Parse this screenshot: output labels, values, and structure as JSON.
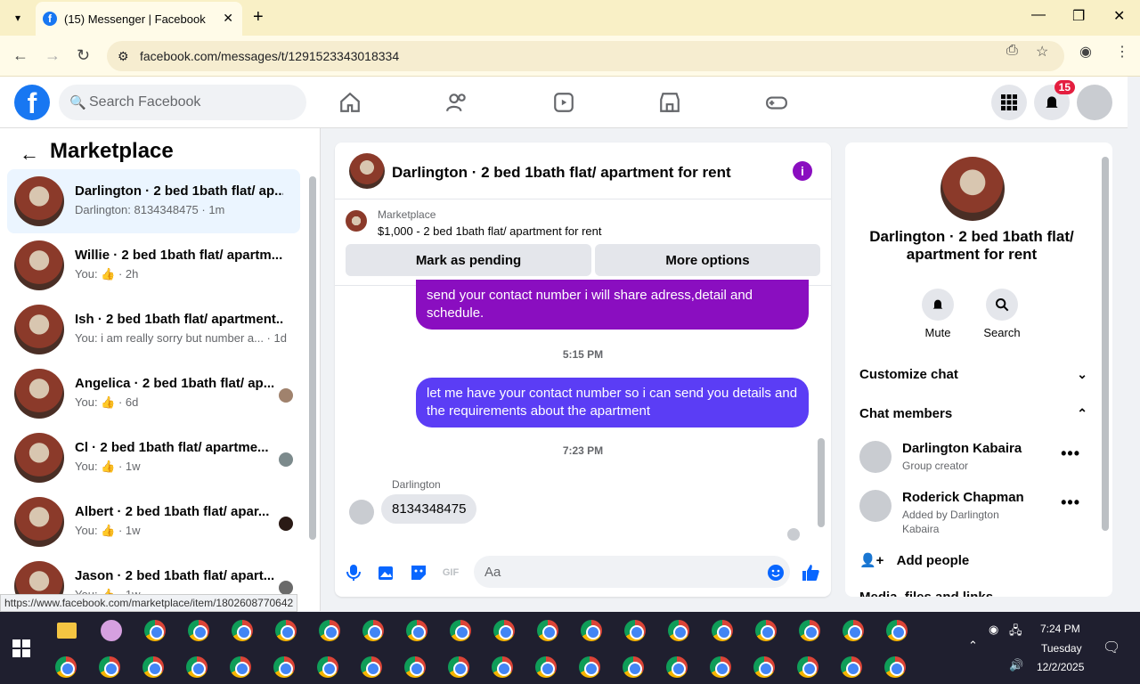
{
  "browser": {
    "tab_title": "(15) Messenger | Facebook",
    "url": "facebook.com/messages/t/1291523343018334"
  },
  "fb": {
    "search_placeholder": "Search Facebook",
    "notif_count": "15"
  },
  "left": {
    "title": "Marketplace",
    "conversations": [
      {
        "title": "Darlington · 2 bed 1bath flat/ ap...",
        "sub": "Darlington: 8134348475 · 1m"
      },
      {
        "title": "Willie · 2 bed 1bath flat/ apartm...",
        "sub": "You: 👍 · 2h"
      },
      {
        "title": "Ish · 2 bed 1bath flat/ apartment...",
        "sub": "You: i am really sorry but number a... · 1d"
      },
      {
        "title": "Angelica · 2 bed 1bath flat/ ap...",
        "sub": "You: 👍 · 6d"
      },
      {
        "title": "Cl · 2 bed 1bath flat/ apartme...",
        "sub": "You: 👍 · 1w"
      },
      {
        "title": "Albert · 2 bed 1bath flat/ apar...",
        "sub": "You: 👍 · 1w"
      },
      {
        "title": "Jason · 2 bed 1bath flat/ apart...",
        "sub": "You: 👍 · 1w"
      }
    ]
  },
  "chat": {
    "title": "Darlington · 2 bed 1bath flat/ apartment for rent",
    "marketplace_label": "Marketplace",
    "listing": "$1,000 - 2 bed 1bath flat/ apartment for rent",
    "mark_pending": "Mark as pending",
    "more_options": "More options",
    "msg1": "send your contact number i will share adress,detail and schedule.",
    "time1": "5:15 PM",
    "msg2": "let me have your contact number so i can send you details and the requirements about the apartment",
    "time2": "7:23 PM",
    "sender": "Darlington",
    "incoming": "8134348475",
    "composer_placeholder": "Aa"
  },
  "right": {
    "title": "Darlington · 2 bed 1bath flat/ apartment for rent",
    "mute": "Mute",
    "search": "Search",
    "customize": "Customize chat",
    "members_header": "Chat members",
    "members": [
      {
        "name": "Darlington Kabaira",
        "sub": "Group creator"
      },
      {
        "name": "Roderick Chapman",
        "sub": "Added by Darlington Kabaira"
      }
    ],
    "add_people": "Add people",
    "media": "Media, files and links"
  },
  "status_url": "https://www.facebook.com/marketplace/item/1802608770642",
  "taskbar": {
    "time": "7:24 PM",
    "day": "Tuesday",
    "date": "12/2/2025"
  },
  "colors": {
    "fb_blue": "#1877f2",
    "bubble_purple": "#8a0ec0",
    "bubble_blue": "#5b3df5"
  }
}
